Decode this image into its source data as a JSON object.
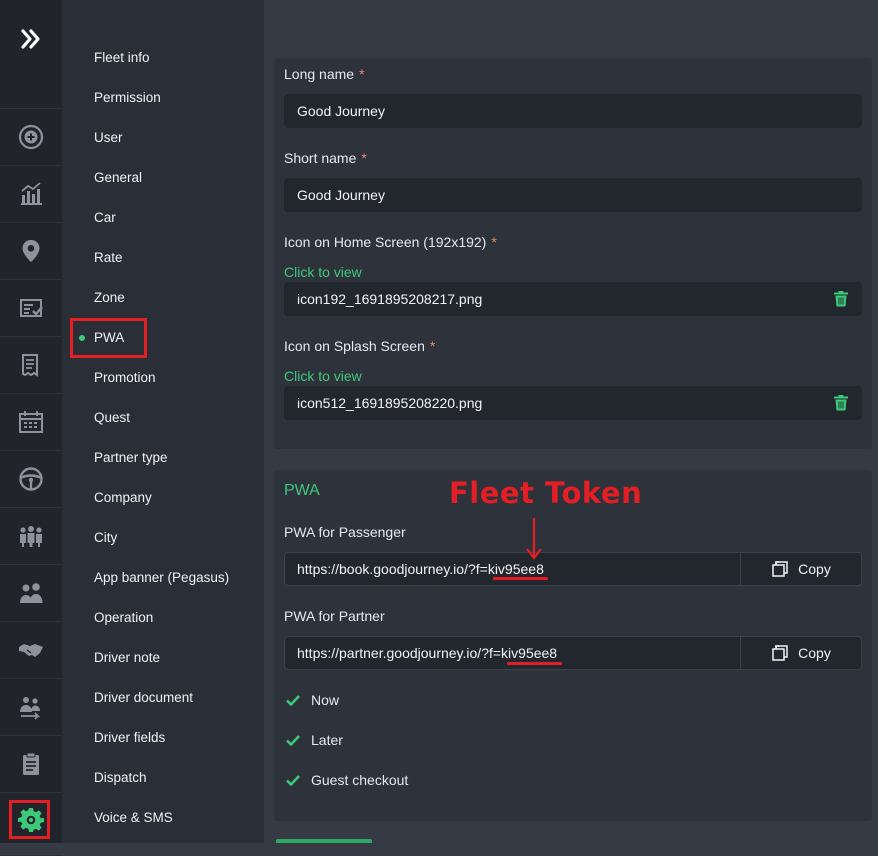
{
  "rail": {
    "expand_icon": "double-chevron-right-icon",
    "items": [
      {
        "icon": "plus-circle-icon"
      },
      {
        "icon": "chart-icon"
      },
      {
        "icon": "map-pin-icon"
      },
      {
        "icon": "checklist-icon"
      },
      {
        "icon": "receipt-icon"
      },
      {
        "icon": "calendar-icon"
      },
      {
        "icon": "steering-wheel-icon"
      },
      {
        "icon": "group-icon"
      },
      {
        "icon": "users-icon"
      },
      {
        "icon": "handshake-icon"
      },
      {
        "icon": "user-transfer-icon"
      },
      {
        "icon": "clipboard-icon"
      },
      {
        "icon": "gear-icon",
        "active": true
      }
    ]
  },
  "menu": {
    "items": [
      "Fleet info",
      "Permission",
      "User",
      "General",
      "Car",
      "Rate",
      "Zone",
      "PWA",
      "Promotion",
      "Quest",
      "Partner type",
      "Company",
      "City",
      "App banner (Pegasus)",
      "Operation",
      "Driver note",
      "Driver document",
      "Driver fields",
      "Dispatch",
      "Voice & SMS"
    ],
    "active": "PWA"
  },
  "form": {
    "long_name_label": "Long name",
    "long_name_value": "Good Journey",
    "short_name_label": "Short name",
    "short_name_value": "Good Journey",
    "icon_home_label": "Icon on Home Screen (192x192)",
    "icon_home_link": "Click to view",
    "icon_home_file": "icon192_1691895208217.png",
    "icon_splash_label": "Icon on Splash Screen",
    "icon_splash_link": "Click to view",
    "icon_splash_file": "icon512_1691895208220.png",
    "required_mark": "*"
  },
  "pwa": {
    "section_title": "PWA",
    "passenger_label": "PWA for Passenger",
    "passenger_url": "https://book.goodjourney.io/?f=kiv95ee8",
    "partner_label": "PWA for Partner",
    "partner_url": "https://partner.goodjourney.io/?f=kiv95ee8",
    "copy_label": "Copy",
    "options": [
      {
        "label": "Now",
        "checked": true
      },
      {
        "label": "Later",
        "checked": true
      },
      {
        "label": "Guest checkout",
        "checked": true
      }
    ]
  },
  "annotation": {
    "text": "Fleet Token",
    "color": "#e31e24"
  },
  "colors": {
    "accent": "#3ec97a",
    "highlight": "#e31e24"
  }
}
